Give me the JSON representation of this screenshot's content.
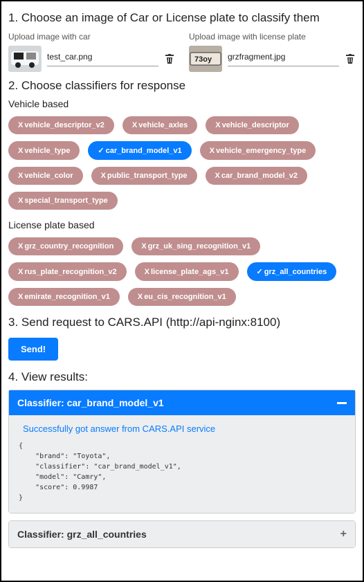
{
  "s1": {
    "title": "1. Choose an image of Car or License plate to classify them",
    "car": {
      "label": "Upload image with car",
      "file": "test_car.png"
    },
    "plate": {
      "label": "Upload image with license plate",
      "file": "grzfragment.jpg"
    }
  },
  "s2": {
    "title": "2. Choose classifiers for response",
    "veh_label": "Vehicle based",
    "veh": [
      {
        "t": "vehicle_descriptor_v2",
        "s": false
      },
      {
        "t": "vehicle_axles",
        "s": false
      },
      {
        "t": "vehicle_descriptor",
        "s": false
      },
      {
        "t": "vehicle_type",
        "s": false
      },
      {
        "t": "car_brand_model_v1",
        "s": true
      },
      {
        "t": "vehicle_emergency_type",
        "s": false
      },
      {
        "t": "vehicle_color",
        "s": false
      },
      {
        "t": "public_transport_type",
        "s": false
      },
      {
        "t": "car_brand_model_v2",
        "s": false
      },
      {
        "t": "special_transport_type",
        "s": false
      }
    ],
    "lp_label": "License plate based",
    "lp": [
      {
        "t": "grz_country_recognition",
        "s": false
      },
      {
        "t": "grz_uk_sing_recognition_v1",
        "s": false
      },
      {
        "t": "rus_plate_recognition_v2",
        "s": false
      },
      {
        "t": "license_plate_ags_v1",
        "s": false
      },
      {
        "t": "grz_all_countries",
        "s": true
      },
      {
        "t": "emirate_recognition_v1",
        "s": false
      },
      {
        "t": "eu_cis_recognition_v1",
        "s": false
      }
    ]
  },
  "s3": {
    "title": "3. Send request to CARS.API (http://api-nginx:8100)",
    "btn": "Send!"
  },
  "s4": {
    "title": "4. View results:",
    "r1": {
      "head": "Classifier: car_brand_model_v1",
      "msg": "Successfully got answer from CARS.API service",
      "json": "{\n    \"brand\": \"Toyota\",\n    \"classifier\": \"car_brand_model_v1\",\n    \"model\": \"Camry\",\n    \"score\": 0.9987\n}"
    },
    "r2": {
      "head": "Classifier: grz_all_countries"
    }
  }
}
